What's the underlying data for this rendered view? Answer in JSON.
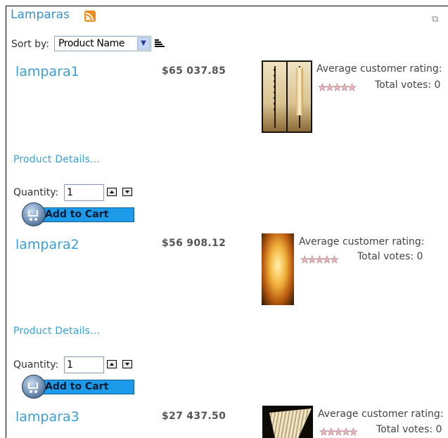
{
  "category": {
    "title": "Lamparas",
    "rss_icon": "rss-icon",
    "compare_icon": "compare-icon"
  },
  "sort": {
    "label": "Sort by:",
    "selected": "Product Name",
    "direction_icon": "sort-descending-icon"
  },
  "products": [
    {
      "name": "lampara1",
      "price": "$65 037.85",
      "rating_label": "Average customer rating:",
      "stars": "★★★★★",
      "votes": "Total votes: 0",
      "details_link": "Product Details...",
      "quantity_label": "Quantity:",
      "quantity": "1",
      "add_to_cart": "Add to Cart"
    },
    {
      "name": "lampara2",
      "price": "$56 908.12",
      "rating_label": "Average customer rating:",
      "stars": "★★★★★",
      "votes": "Total votes: 0",
      "details_link": "Product Details...",
      "quantity_label": "Quantity:",
      "quantity": "1",
      "add_to_cart": "Add to Cart"
    },
    {
      "name": "lampara3",
      "price": "$27 437.50",
      "rating_label": "Average customer rating:",
      "stars": "★★★★★",
      "votes": "Total votes: 0"
    }
  ],
  "colors": {
    "link": "#3a9fd6",
    "cart_button": "#1e9be8",
    "rss": "#f08a1c"
  }
}
